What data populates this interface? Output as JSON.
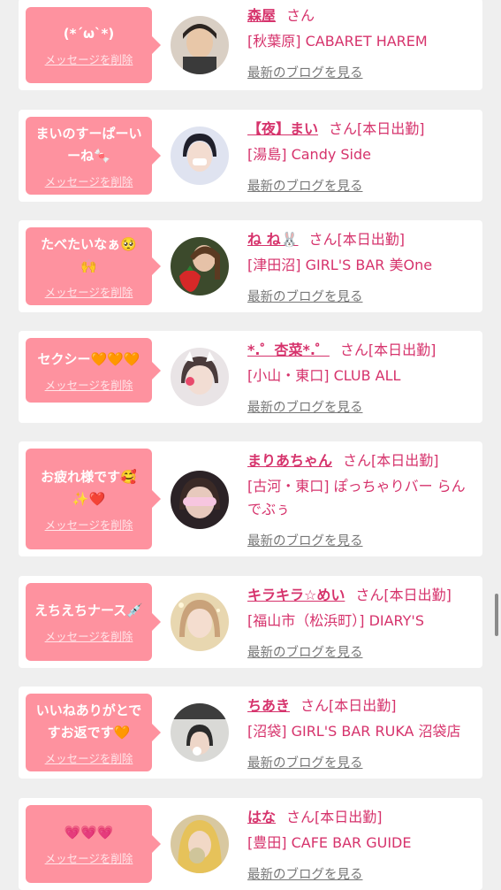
{
  "entries": [
    {
      "message": "(*´ω`*)",
      "delete_link": "メッセージを削除",
      "name": "森屋",
      "honorific": "さん",
      "status": "",
      "shop": "[秋葉原] CABARET HAREM",
      "blog_link": "最新のブログを見る"
    },
    {
      "message": "まいのすーぱーいーね🍬",
      "delete_link": "メッセージを削除",
      "name": "【夜】まい",
      "honorific": "さん",
      "status": "[本日出勤]",
      "shop": "[湯島] Candy Side",
      "blog_link": "最新のブログを見る"
    },
    {
      "message": "たべたいなぁ🥺🙌",
      "delete_link": "メッセージを削除",
      "name": "ね ね🐰",
      "honorific": "さん",
      "status": "[本日出勤]",
      "shop": "[津田沼] GIRL'S BAR 美One",
      "blog_link": "最新のブログを見る"
    },
    {
      "message": "セクシー🧡🧡🧡",
      "delete_link": "メッセージを削除",
      "name": "*.゜杏菜*.゜",
      "honorific": "さん",
      "status": "[本日出勤]",
      "shop": "[小山・東口] CLUB ALL",
      "blog_link": "最新のブログを見る"
    },
    {
      "message": "お疲れ様です🥰✨❤️",
      "delete_link": "メッセージを削除",
      "name": "まりあちゃん",
      "honorific": "さん",
      "status": "[本日出勤]",
      "shop": "[古河・東口] ぽっちゃりバー らんでぶぅ",
      "blog_link": "最新のブログを見る"
    },
    {
      "message": "えちえちナース💉",
      "delete_link": "メッセージを削除",
      "name": "キラキラ☆めい",
      "honorific": "さん",
      "status": "[本日出勤]",
      "shop": "[福山市（松浜町）] DIARY'S",
      "blog_link": "最新のブログを見る"
    },
    {
      "message": "いいねありがとですお返です🧡",
      "delete_link": "メッセージを削除",
      "name": "ちあき",
      "honorific": "さん",
      "status": "[本日出勤]",
      "shop": "[沼袋] GIRL'S BAR RUKA 沼袋店",
      "blog_link": "最新のブログを見る"
    },
    {
      "message": "💗💗💗",
      "delete_link": "メッセージを削除",
      "name": "はな",
      "honorific": "さん",
      "status": "[本日出勤]",
      "shop": "[豊田] CAFE BAR GUIDE",
      "blog_link": "最新のブログを見る"
    }
  ],
  "colors": {
    "bubble": "#fe929f",
    "name": "#d6336c",
    "link_gray": "#777777",
    "background": "#efefef"
  }
}
